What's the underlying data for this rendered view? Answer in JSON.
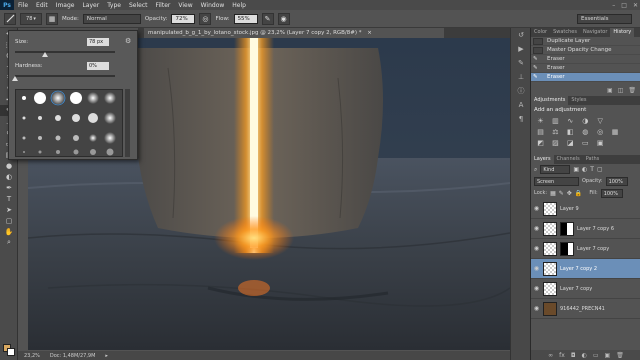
{
  "menubar": {
    "logo": "Ps",
    "items": [
      "File",
      "Edit",
      "Image",
      "Layer",
      "Type",
      "Select",
      "Filter",
      "View",
      "Window",
      "Help"
    ],
    "window_controls": [
      "–",
      "□",
      "✕"
    ]
  },
  "options": {
    "mode_label": "Mode:",
    "mode_value": "Normal",
    "opacity_label": "Opacity:",
    "opacity_value": "72%",
    "flow_label": "Flow:",
    "flow_value": "55%",
    "brush_size_badge": "78",
    "workspace": "Essentials"
  },
  "brush_picker": {
    "size_label": "Size:",
    "size_value": "78 px",
    "hardness_label": "Hardness:",
    "hardness_value": "0%",
    "size_fraction": 0.3,
    "hardness_fraction": 0.0
  },
  "document": {
    "tab_title": "manipulated_b_g_1_by_lotano_stock.jpg @ 23,2% (Layer 7 copy 2, RGB/8#) *",
    "close": "×"
  },
  "status": {
    "zoom": "23,2%",
    "doc_info": "Doc: 1,48M/27,9M"
  },
  "history": {
    "tabs": [
      "Color",
      "Swatches",
      "Navigator",
      "History"
    ],
    "active_tab": "History",
    "items": [
      {
        "label": "Duplicate Layer",
        "selected": false
      },
      {
        "label": "Master Opacity Change",
        "selected": false
      },
      {
        "label": "Eraser",
        "selected": false
      },
      {
        "label": "Eraser",
        "selected": false
      },
      {
        "label": "Eraser",
        "selected": true
      }
    ]
  },
  "adjustments": {
    "tabs": [
      "Adjustments",
      "Styles"
    ],
    "active_tab": "Adjustments",
    "heading": "Add an adjustment"
  },
  "layers": {
    "tabs": [
      "Layers",
      "Channels",
      "Paths"
    ],
    "active_tab": "Layers",
    "kind_label": "Kind",
    "blend_mode": "Screen",
    "opacity_label": "Opacity:",
    "opacity_value": "100%",
    "lock_label": "Lock:",
    "fill_label": "Fill:",
    "fill_value": "100%",
    "items": [
      {
        "name": "Layer 9",
        "selected": false,
        "mask": false
      },
      {
        "name": "Layer 7 copy 6",
        "selected": false,
        "mask": true
      },
      {
        "name": "Layer 7 copy",
        "selected": false,
        "mask": true
      },
      {
        "name": "Layer 7 copy 2",
        "selected": true,
        "mask": false
      },
      {
        "name": "Layer 7 copy",
        "selected": false,
        "mask": false
      },
      {
        "name": "916442_PRECN41",
        "selected": false,
        "mask": false
      }
    ]
  },
  "colors": {
    "foreground": "#d8a860",
    "background": "#ffffff",
    "selection": "#6b8fb8",
    "glow": "#ffb020"
  }
}
